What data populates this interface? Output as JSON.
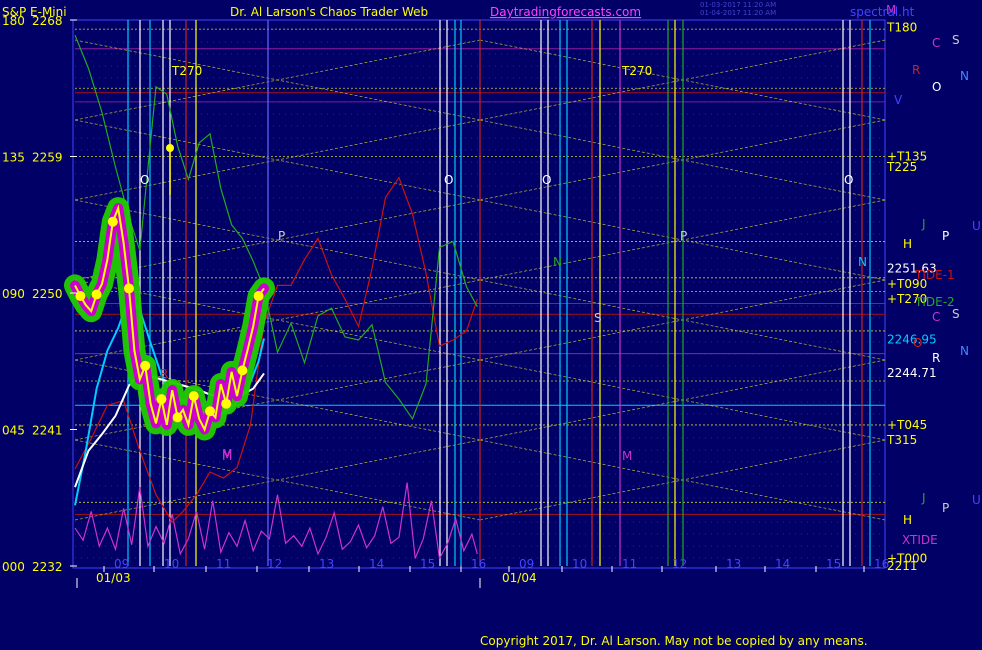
{
  "header": {
    "instrument": "S&P E-Mini",
    "site_title": "Dr. Al Larson's Chaos Trader Web",
    "site_url": "Daytradingforecasts.com",
    "timestamp_1": "01-03-2017 11:20 AM",
    "timestamp_2": "01-04-2017 11:20 AM",
    "corner": "spectral.ht"
  },
  "footer": {
    "copyright": "Copyright 2017, Dr. Al Larson. May not be copied by any means."
  },
  "colors": {
    "background": "#000066",
    "price_line": "#ffff00",
    "price_glow": "#22cc00",
    "price_magenta": "#cc00cc",
    "cyan_avg": "#00ccff",
    "white_avg": "#ffffff",
    "tide_red": "#cc1111",
    "tide_green": "#22aa22",
    "xtide": "#cc33cc"
  },
  "chart_data": {
    "type": "line",
    "title": "S&P E-Mini",
    "y_left_angle_ticks": [
      "180",
      "135",
      "090",
      "045",
      "000"
    ],
    "y_left_price_ticks": [
      "2268",
      "2259",
      "2250",
      "2241",
      "2232"
    ],
    "ylim": [
      2232,
      2268
    ],
    "x_hour_ticks": [
      "09",
      "10",
      "11",
      "12",
      "13",
      "14",
      "15",
      "16",
      "09",
      "10",
      "11",
      "12",
      "13",
      "14",
      "15",
      "16"
    ],
    "x_date_labels": [
      "01/03",
      "01/04"
    ],
    "right_labels": [
      {
        "text": "T180",
        "price": 2267.5,
        "color": "#ffff00"
      },
      {
        "text": "+T135",
        "price": 2259,
        "color": "#ffff00"
      },
      {
        "text": "T225",
        "price": 2258.3,
        "color": "#ffff00"
      },
      {
        "text": "2251.63",
        "price": 2251.63,
        "color": "#ffffff"
      },
      {
        "text": "+T090",
        "price": 2250.6,
        "color": "#ffff00"
      },
      {
        "text": "+T270",
        "price": 2249.6,
        "color": "#ffff00"
      },
      {
        "text": "2246.95",
        "price": 2246.95,
        "color": "#00ccff"
      },
      {
        "text": "2244.71",
        "price": 2244.71,
        "color": "#ffffff"
      },
      {
        "text": "+T045",
        "price": 2241.3,
        "color": "#ffff00"
      },
      {
        "text": "T315",
        "price": 2240.3,
        "color": "#ffff00"
      },
      {
        "text": "+T000",
        "price": 2232.5,
        "color": "#ffff00"
      },
      {
        "text": "2211",
        "price": 2232,
        "color": "#ffff00"
      }
    ],
    "tide_labels": [
      {
        "text": "TIDE-1",
        "color": "#cc1111"
      },
      {
        "text": "TIDE-2",
        "color": "#22aa22"
      },
      {
        "text": "XTIDE",
        "color": "#cc33cc"
      }
    ],
    "planet_marks": [
      "M",
      "C",
      "S",
      "R",
      "N",
      "O",
      "V",
      "J",
      "P",
      "U",
      "H",
      "C",
      "S",
      "O",
      "N",
      "R",
      "J",
      "P",
      "U",
      "H",
      "M"
    ],
    "chart_annotations": [
      "T270",
      "T270",
      "O",
      "O",
      "O",
      "O",
      "P",
      "P",
      "N",
      "N",
      "S",
      "M",
      "M",
      "R"
    ],
    "series": [
      {
        "name": "price",
        "x": [
          0,
          0.2,
          0.4,
          0.6,
          0.8,
          1.0,
          1.2,
          1.4,
          1.6,
          1.8,
          2.0,
          2.2,
          2.4,
          2.6,
          2.8,
          3.0,
          3.2,
          3.4,
          3.6,
          3.8,
          4.0,
          4.2,
          4.4,
          4.6,
          4.8,
          5.0,
          5.2,
          5.4,
          5.6,
          5.8,
          6.0,
          6.2,
          6.4,
          6.6,
          6.8,
          7.0
        ],
        "values": [
          2250.5,
          2249.8,
          2249.2,
          2248.8,
          2249.9,
          2250.6,
          2252.2,
          2254.7,
          2255.6,
          2253.3,
          2250.3,
          2246.2,
          2244.3,
          2245.2,
          2242.7,
          2241.4,
          2243.0,
          2241.3,
          2243.6,
          2241.8,
          2242.3,
          2241.3,
          2243.2,
          2241.7,
          2241.0,
          2242.2,
          2241.8,
          2244.0,
          2242.7,
          2244.8,
          2243.2,
          2244.9,
          2246.3,
          2247.8,
          2249.8,
          2250.3
        ]
      },
      {
        "name": "cyan-average",
        "x": [
          0,
          0.4,
          0.8,
          1.2,
          1.6,
          2.0,
          2.4,
          2.8,
          3.2,
          3.6,
          4.0,
          4.4,
          4.8,
          5.2,
          5.6,
          6.0,
          6.4,
          6.8,
          7.0
        ],
        "values": [
          2236.0,
          2239.6,
          2243.7,
          2246.2,
          2247.7,
          2249.7,
          2248.9,
          2246.7,
          2244.6,
          2243.2,
          2242.9,
          2242.5,
          2242.1,
          2241.8,
          2242.2,
          2242.8,
          2243.7,
          2245.5,
          2247.0
        ]
      },
      {
        "name": "white-average",
        "x": [
          0,
          0.5,
          1.0,
          1.5,
          2.0,
          2.2,
          2.6,
          3.0,
          3.4,
          3.8,
          4.2,
          4.6,
          5.0,
          5.4,
          5.8,
          6.2,
          6.6,
          7.0
        ],
        "values": [
          2237.2,
          2239.6,
          2240.7,
          2241.9,
          2243.9,
          2244.3,
          2244.6,
          2244.4,
          2244.2,
          2244.0,
          2243.8,
          2243.6,
          2243.3,
          2243.2,
          2243.1,
          2243.3,
          2243.7,
          2244.7
        ]
      },
      {
        "name": "TIDE-1",
        "x": [
          0,
          0.6,
          1.2,
          1.8,
          2.4,
          3.0,
          3.6,
          4.0,
          4.5,
          5.0,
          5.5,
          6.0,
          6.5,
          7.0,
          7.5,
          8.0,
          8.5,
          9.0,
          9.5,
          10.0,
          10.5,
          11.0,
          11.5,
          12.0,
          12.5,
          13.0,
          13.5,
          14.0,
          14.5,
          14.9
        ],
        "values": [
          2238.4,
          2240.4,
          2242.6,
          2242.9,
          2239.6,
          2236.7,
          2234.9,
          2235.6,
          2236.7,
          2238.2,
          2237.8,
          2238.5,
          2241.3,
          2248.0,
          2250.5,
          2250.5,
          2252.2,
          2253.6,
          2251.2,
          2249.6,
          2247.8,
          2251.6,
          2256.3,
          2257.6,
          2255.2,
          2251.3,
          2246.5,
          2246.9,
          2247.5,
          2249.6
        ]
      },
      {
        "name": "TIDE-2",
        "x": [
          0,
          0.5,
          1.0,
          1.5,
          2.0,
          2.4,
          3.0,
          3.4,
          3.8,
          4.2,
          4.6,
          5.0,
          5.4,
          5.8,
          6.2,
          6.6,
          7.0,
          7.5,
          8.0,
          8.5,
          9.0,
          9.5,
          10.0,
          10.5,
          11.0,
          11.5,
          12.0,
          12.5,
          13.0,
          13.5,
          14.0,
          14.5,
          14.9
        ],
        "values": [
          2267.0,
          2264.8,
          2261.9,
          2258.3,
          2255.0,
          2252.8,
          2263.6,
          2263.1,
          2259.7,
          2257.5,
          2259.9,
          2260.5,
          2256.9,
          2254.5,
          2253.6,
          2252.1,
          2250.3,
          2246.1,
          2248.0,
          2245.4,
          2248.5,
          2249.0,
          2247.1,
          2246.9,
          2247.9,
          2244.1,
          2243.0,
          2241.7,
          2244.0,
          2253.0,
          2253.4,
          2250.4,
          2249.1
        ]
      },
      {
        "name": "XTIDE",
        "x": [
          0,
          0.3,
          0.6,
          0.9,
          1.2,
          1.5,
          1.8,
          2.1,
          2.4,
          2.7,
          3.0,
          3.3,
          3.6,
          3.9,
          4.2,
          4.5,
          4.8,
          5.1,
          5.4,
          5.7,
          6.0,
          6.3,
          6.6,
          6.9,
          7.2,
          7.5,
          7.8,
          8.1,
          8.4,
          8.7,
          9.0,
          9.3,
          9.6,
          9.9,
          10.2,
          10.5,
          10.8,
          11.1,
          11.4,
          11.7,
          12.0,
          12.3,
          12.6,
          12.9,
          13.2,
          13.5,
          13.8,
          14.1,
          14.4,
          14.7,
          14.9
        ],
        "values": [
          2234.5,
          2233.7,
          2235.6,
          2233.3,
          2234.5,
          2233.1,
          2235.8,
          2233.4,
          2237.2,
          2233.3,
          2234.6,
          2233.5,
          2235.4,
          2232.8,
          2233.8,
          2235.6,
          2233.1,
          2236.3,
          2232.9,
          2234.2,
          2233.3,
          2235.0,
          2233.0,
          2234.3,
          2233.8,
          2236.7,
          2233.5,
          2234.0,
          2233.3,
          2234.5,
          2232.8,
          2233.9,
          2235.5,
          2233.1,
          2233.6,
          2234.7,
          2233.2,
          2234.0,
          2235.9,
          2233.5,
          2233.9,
          2237.5,
          2232.5,
          2233.8,
          2236.3,
          2232.5,
          2233.5,
          2235.1,
          2233.0,
          2234.1,
          2232.8
        ]
      }
    ]
  }
}
